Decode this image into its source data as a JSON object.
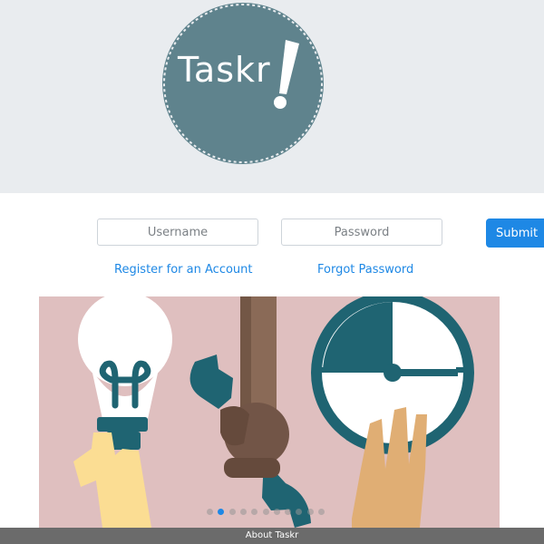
{
  "logo": {
    "text": "Taskr",
    "exclamation": "!"
  },
  "login": {
    "username_placeholder": "Username",
    "password_placeholder": "Password",
    "submit_label": "Submit",
    "register_link": "Register for an Account",
    "forgot_link": "Forgot Password"
  },
  "carousel": {
    "slide_count": 11,
    "active_index": 1,
    "icons": [
      "lightbulb-icon",
      "wrench-icon",
      "clock-icon"
    ]
  },
  "footer": {
    "label": "About Taskr"
  },
  "colors": {
    "header_bg": "#e9ecef",
    "logo_circle": "#5f838d",
    "accent": "#1e88e5",
    "carousel_bg": "#dfbfbf",
    "footer_bg": "#6b6b6b"
  }
}
